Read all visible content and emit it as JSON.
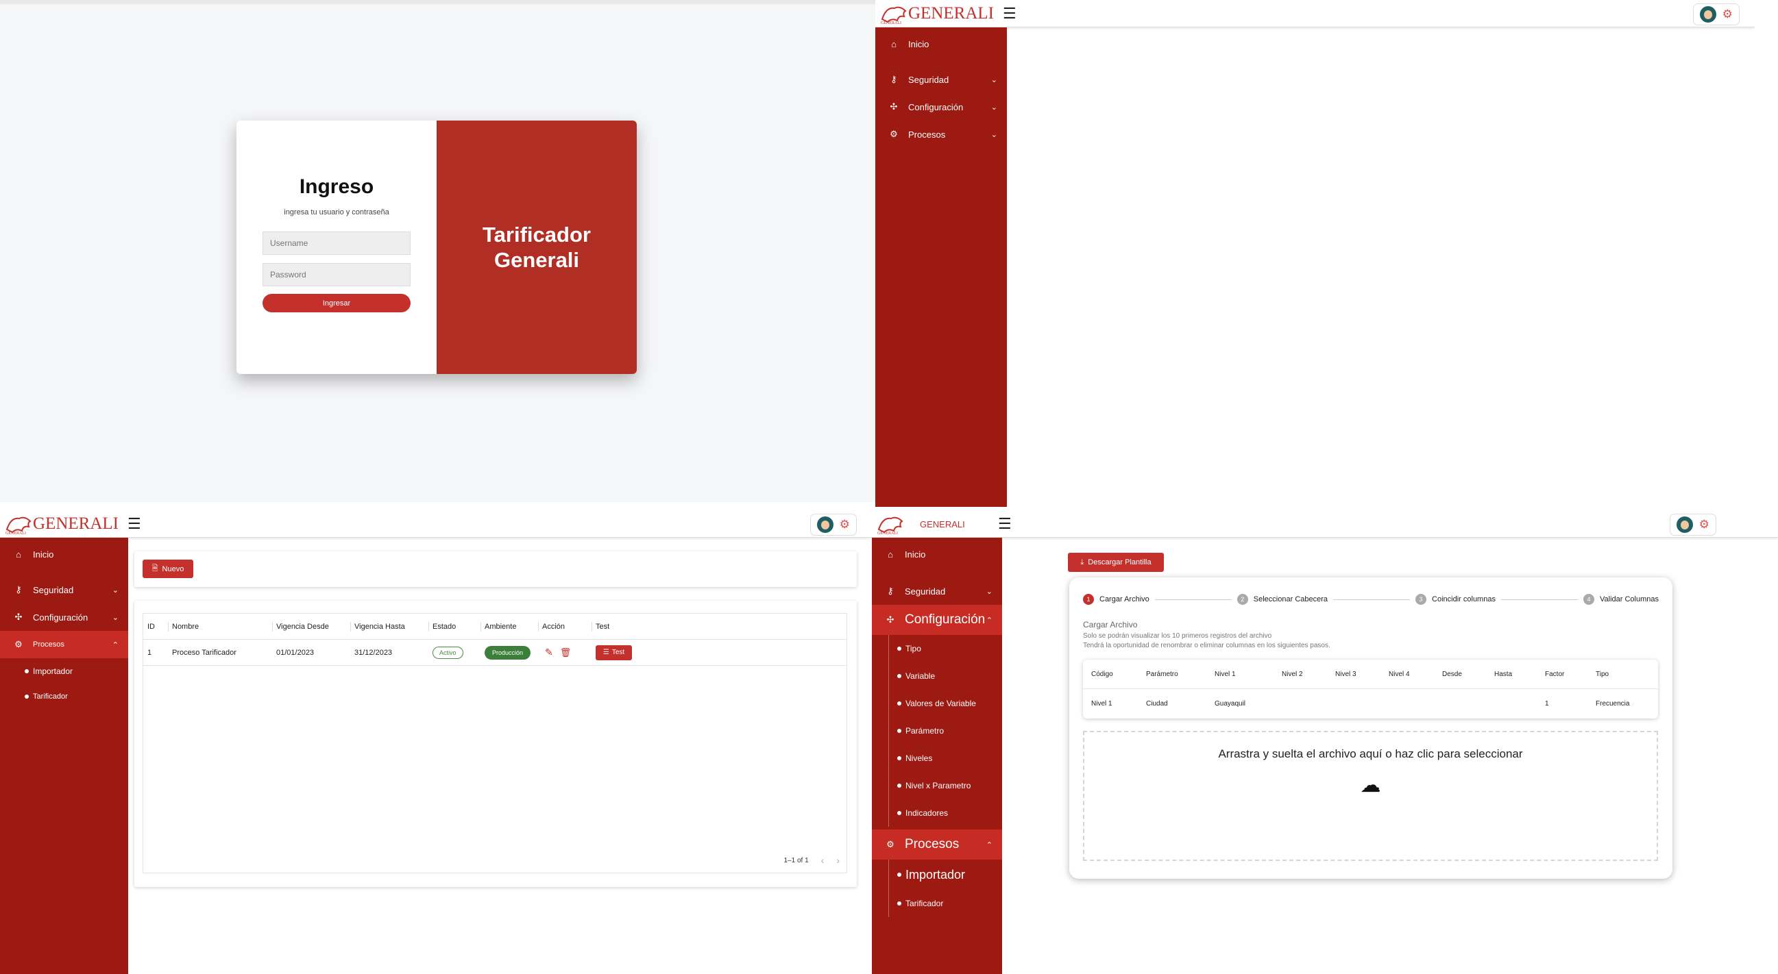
{
  "login": {
    "title": "Ingreso",
    "subtitle": "ingresa tu usuario y contraseña",
    "username_placeholder": "Username",
    "password_placeholder": "Password",
    "submit_label": "Ingresar",
    "brand_text_line1": "Tarificador",
    "brand_text_line2": "Generali"
  },
  "header": {
    "logo_text": "GENERALI",
    "menu_icon": "hamburger-icon",
    "settings_icon": "gear-icon"
  },
  "sidebar": {
    "inicio": "Inicio",
    "seguridad": "Seguridad",
    "configuracion": "Configuración",
    "procesos": "Procesos",
    "procesos_items": [
      "Importador",
      "Tarificador"
    ],
    "configuracion_items": [
      "Tipo",
      "Variable",
      "Valores de Variable",
      "Parámetro",
      "Niveles",
      "Nivel x Parametro",
      "Indicadores"
    ]
  },
  "procesos_page": {
    "new_button": "Nuevo",
    "columns": [
      "ID",
      "Nombre",
      "Vigencia Desde",
      "Vigencia Hasta",
      "Estado",
      "Ambiente",
      "Acción",
      "Test"
    ],
    "rows": [
      {
        "id": "1",
        "nombre": "Proceso Tarificador",
        "desde": "01/01/2023",
        "hasta": "31/12/2023",
        "estado": "Activo",
        "ambiente": "Producción",
        "test": "Test"
      }
    ],
    "pagination": "1–1 of 1"
  },
  "importador_page": {
    "download_button": "Descargar Plantilla",
    "steps": [
      {
        "num": "1",
        "label": "Cargar Archivo"
      },
      {
        "num": "2",
        "label": "Seleccionar Cabecera"
      },
      {
        "num": "3",
        "label": "Coincidir columnas"
      },
      {
        "num": "4",
        "label": "Validar Columnas"
      }
    ],
    "section_title": "Cargar Archivo",
    "info_line1": "Solo se podrán visualizar los 10 primeros registros del archivo",
    "info_line2": "Tendrá la oportunidad de renombrar o eliminar columnas en los siguientes pasos.",
    "preview_headers": [
      "Código",
      "Parámetro",
      "Nivel 1",
      "Nivel 2",
      "Nivel 3",
      "Nivel 4",
      "Desde",
      "Hasta",
      "Factor",
      "Tipo"
    ],
    "preview_row": [
      "Nivel 1",
      "Ciudad",
      "Guayaquil",
      "",
      "",
      "",
      "",
      "",
      "1",
      "Frecuencia"
    ],
    "dropzone_text": "Arrastra y suelta el archivo aquí o haz clic para seleccionar"
  },
  "colors": {
    "brand_red": "#c4302b",
    "sidebar_red": "#9c1a12",
    "success_green": "#3c7f39"
  }
}
